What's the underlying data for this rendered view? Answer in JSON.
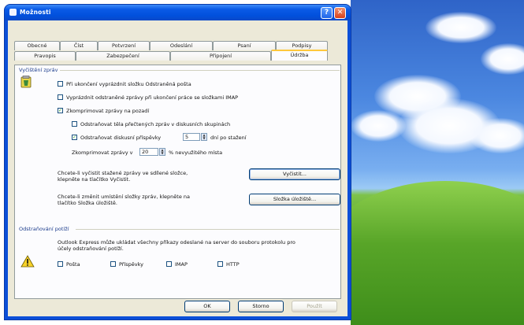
{
  "window": {
    "title": "Možnosti",
    "help_glyph": "?",
    "close_glyph": "✕"
  },
  "tabs_row1": [
    "Obecné",
    "Číst",
    "Potvrzení",
    "Odeslání",
    "Psaní",
    "Podpisy"
  ],
  "tabs_row2": [
    "Pravopis",
    "Zabezpečení",
    "Připojení",
    "Údržba"
  ],
  "active_tab": "Údržba",
  "cleanup": {
    "group_title": "Vyčištění zpráv",
    "opt1": {
      "label": "Při ukončení vyprázdnit složku Odstraněná pošta",
      "checked": false
    },
    "opt2": {
      "label": "Vyprázdnit odstraněné zprávy při ukončení práce se složkami IMAP",
      "checked": false
    },
    "opt3": {
      "label": "Zkomprimovat zprávy na pozadí",
      "checked": true
    },
    "opt4": {
      "label": "Odstraňovat těla přečtených zpráv v diskusních skupinách",
      "checked": false
    },
    "opt5": {
      "label": "Odstraňovat diskusní příspěvky",
      "checked": true,
      "value": "5",
      "suffix": "dní po stažení"
    },
    "compress": {
      "label": "Zkomprimovat zprávy v",
      "value": "20",
      "suffix": "% nevyužitého místa"
    },
    "clean_text": "Chcete-li vyčistit stažené zprávy ve sdílené složce, klepněte na tlačítko Vyčistit.",
    "clean_button": "Vyčistit...",
    "store_text": "Chcete-li změnit umístění složky zpráv, klepněte na tlačítko Složka úložiště.",
    "store_button": "Složka úložiště..."
  },
  "troubleshoot": {
    "group_title": "Odstraňování potíží",
    "text": "Outlook Express může ukládat všechny příkazy odeslané na server do souboru protokolu pro účely odstraňování potíží.",
    "options": [
      {
        "label": "Pošta",
        "checked": false
      },
      {
        "label": "Příspěvky",
        "checked": false
      },
      {
        "label": "IMAP",
        "checked": false
      },
      {
        "label": "HTTP",
        "checked": false
      }
    ]
  },
  "footer": {
    "ok": "OK",
    "cancel": "Storno",
    "apply": "Použít"
  },
  "colors": {
    "xp_blue": "#0150dc",
    "tab_highlight": "#ffc83c",
    "dialog_bg": "#ece9d8",
    "check_green": "#21a121"
  }
}
